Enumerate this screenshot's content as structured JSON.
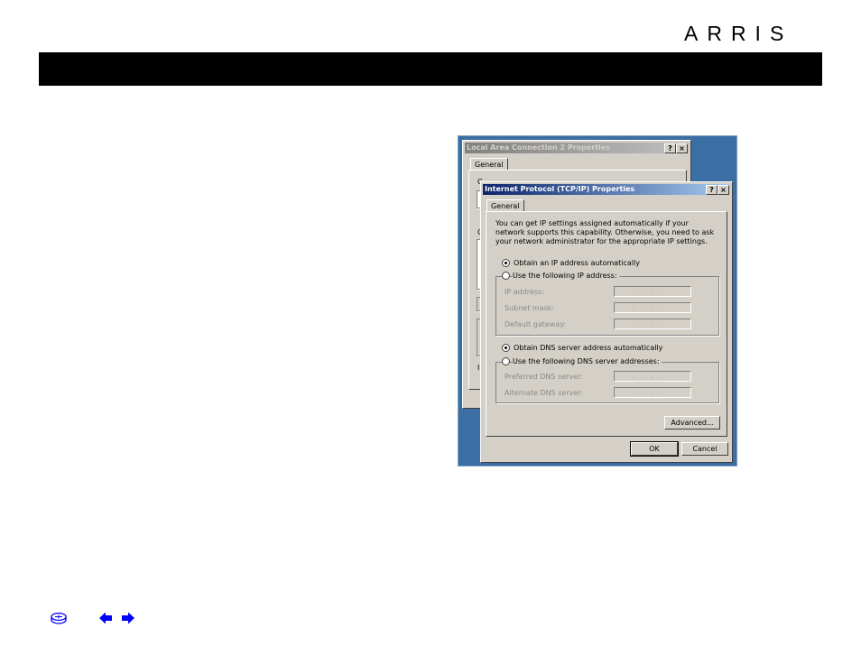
{
  "brand": {
    "logo": "ARRIS"
  },
  "dialog_back": {
    "title": "Local Area Connection 2 Properties",
    "tab": "General",
    "help_btn": "?",
    "close_btn": "×",
    "partial_labels": [
      "C",
      "C",
      "I"
    ]
  },
  "dialog_front": {
    "title": "Internet Protocol (TCP/IP) Properties",
    "help_btn": "?",
    "close_btn": "×",
    "tab": "General",
    "intro": "You can get IP settings assigned automatically if your network supports this capability. Otherwise, you need to ask your network administrator for the appropriate IP settings.",
    "ip_auto": "Obtain an IP address automatically",
    "ip_manual": "Use the following IP address:",
    "ip_fields": [
      {
        "label": "IP address:",
        "value": "...."
      },
      {
        "label": "Subnet mask:",
        "value": "...."
      },
      {
        "label": "Default gateway:",
        "value": "...."
      }
    ],
    "dns_auto": "Obtain DNS server address automatically",
    "dns_manual": "Use the following DNS server addresses:",
    "dns_fields": [
      {
        "label": "Preferred DNS server:",
        "value": "...."
      },
      {
        "label": "Alternate DNS server:",
        "value": "...."
      }
    ],
    "advanced": "Advanced...",
    "ok": "OK",
    "cancel": "Cancel"
  },
  "colors": {
    "desktop": "#3a6ea5",
    "nav_blue": "#0000ff"
  },
  "nav": {
    "home_icon": "router-icon",
    "prev_icon": "arrow-left-icon",
    "next_icon": "arrow-right-icon"
  }
}
